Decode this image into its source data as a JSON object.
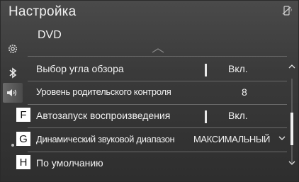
{
  "header": {
    "title": "Настройка",
    "status_icon": "phone-disabled-icon"
  },
  "sidebar": {
    "items": [
      {
        "name": "settings-gear-icon",
        "glyph": "⚙"
      },
      {
        "name": "bluetooth-icon",
        "glyph": "ᛒ"
      },
      {
        "name": "speaker-icon",
        "glyph": "◀))"
      },
      {
        "name": "car-icon",
        "glyph": ""
      }
    ]
  },
  "main": {
    "section_title": "DVD",
    "rows": [
      {
        "label": "Выбор угла обзора",
        "value": "Вкл.",
        "has_toggle": true
      },
      {
        "label": "Уровень родительского контроля",
        "value": "8",
        "has_toggle": false
      },
      {
        "label": "Автозапуск воспроизведения",
        "value": "Вкл.",
        "has_toggle": true,
        "callout": "F"
      },
      {
        "label": "Динамический звуковой диапазон",
        "value": "МАКСИМАЛЬНЫЙ",
        "has_dropdown": true,
        "callout": "G"
      },
      {
        "label": "По умолчанию",
        "value": "",
        "callout": "H"
      }
    ]
  },
  "scrollbar": {
    "up_icon": "chevron-up-icon",
    "down_icon": "chevron-down-icon"
  },
  "colors": {
    "background": "#3a3a3a",
    "text": "#f2f2f2",
    "divider": "#6a6a6a",
    "callout_box": "#ffffff"
  }
}
